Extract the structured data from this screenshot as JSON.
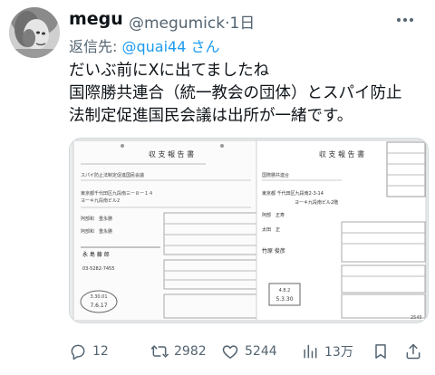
{
  "post": {
    "author_name": "megu",
    "author_handle": "@megumick",
    "separator": "·",
    "time": "1日",
    "reply_prefix": "返信先:",
    "reply_to": "@quai44 さん",
    "text_lines": [
      "だいぶ前にXに出てましたね",
      "国際勝共連合（統一教会の団体）とスパイ防止",
      "法制定促進国民会議は出所が一緒です。"
    ]
  },
  "media": {
    "left_doc": {
      "title": "収 支 報 告 書",
      "org": "スパイ防止法制定促進国民会議",
      "address_1": "東京都千代田区九段南三ー８ー１４",
      "address_2": "ヨーキ九段南ビル2",
      "rep": "阿部和　重永勝",
      "accountant": "阿部和　重永勝",
      "signer": "永 島 藤 郎",
      "phone": "03-5282-7455",
      "stamp_top": "3.30.01",
      "stamp_date": "7.6.17"
    },
    "right_doc": {
      "title": "収 支 報 告 書",
      "org": "国際勝共連合",
      "address": "東京都 千代田区九段南2-3-14",
      "address_2": "ヨーキ九段南ビル2階",
      "rep": "阿部　正寿",
      "accountant": "太田　正",
      "handwritten_name": "竹原 俊彦",
      "stamp_top": "4.8.2",
      "stamp_date": "5.3.30",
      "page_number": "2545"
    }
  },
  "actions": {
    "replies": "12",
    "reposts": "2982",
    "likes": "5244",
    "views": "13万"
  }
}
